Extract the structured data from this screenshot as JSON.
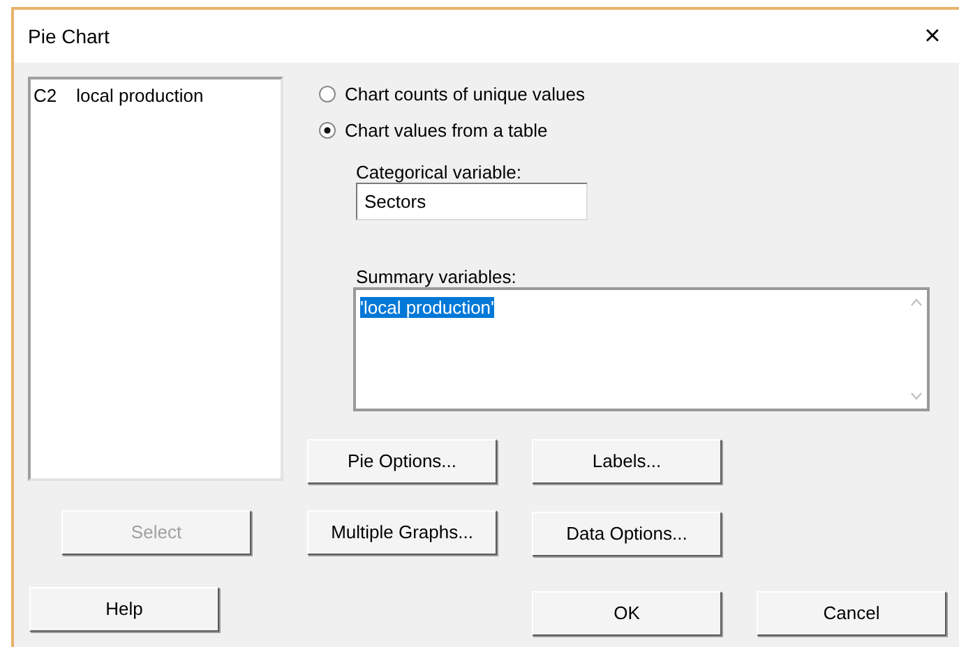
{
  "window": {
    "title": "Pie Chart",
    "close": "×"
  },
  "variables_list": [
    {
      "column": "C2",
      "name": "local production"
    }
  ],
  "radios": [
    {
      "label": "Chart counts of unique values",
      "selected": false
    },
    {
      "label": "Chart values from a table",
      "selected": true
    }
  ],
  "categorical_variable": {
    "label": "Categorical variable:",
    "value": "Sectors"
  },
  "summary_variables": {
    "label": "Summary variables:",
    "value": "'local production'",
    "selected": true
  },
  "buttons": [
    {
      "label": "Pie Options...",
      "disabled": false
    },
    {
      "label": "Labels...",
      "disabled": false
    },
    {
      "label": "Select",
      "disabled": true
    },
    {
      "label": "Multiple Graphs...",
      "disabled": false
    },
    {
      "label": "Data Options...",
      "disabled": false
    },
    {
      "label": "Help",
      "disabled": false
    },
    {
      "label": "OK",
      "disabled": false
    },
    {
      "label": "Cancel",
      "disabled": false
    }
  ]
}
